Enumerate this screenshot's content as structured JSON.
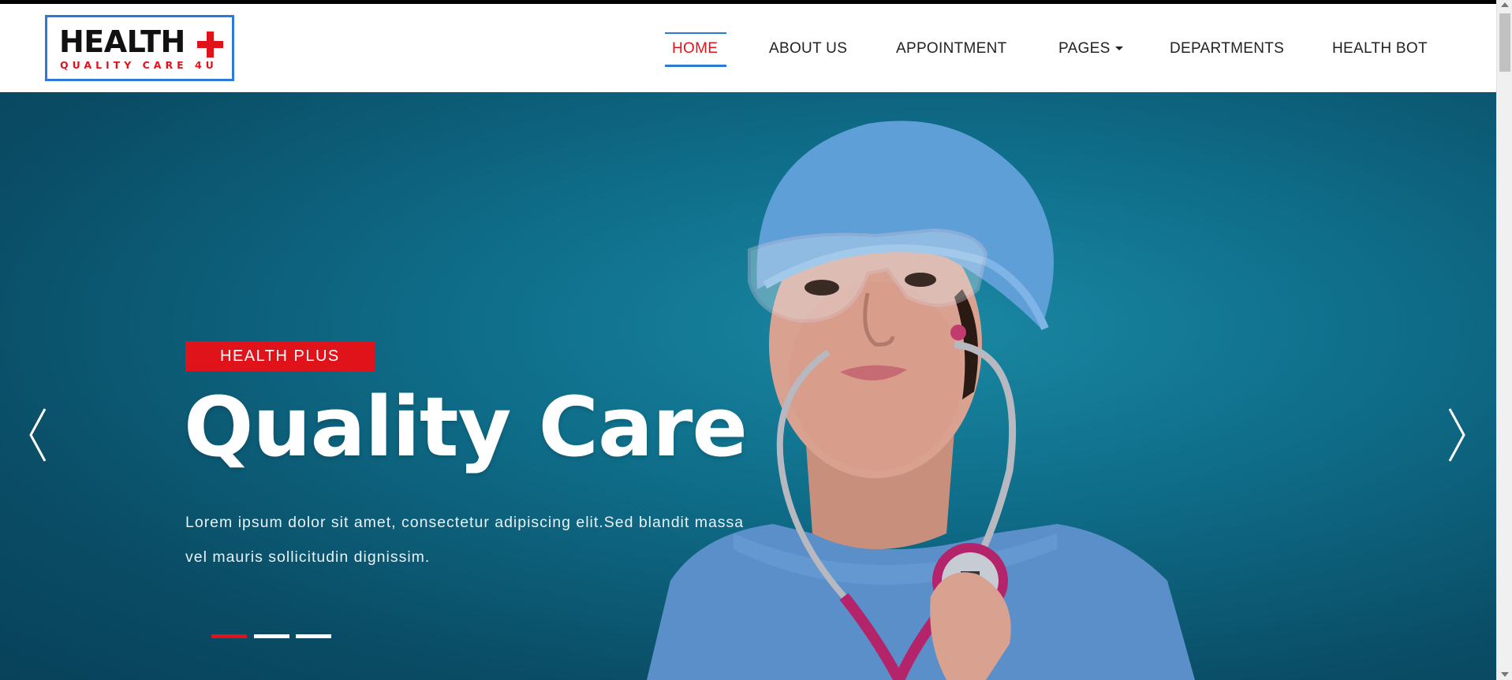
{
  "brand": {
    "name": "HEALTH",
    "tagline": "QUALITY CARE 4U",
    "accent": "#e0131a",
    "border": "#2b7ad6"
  },
  "nav": {
    "items": [
      {
        "label": "HOME",
        "active": true
      },
      {
        "label": "ABOUT US",
        "active": false
      },
      {
        "label": "APPOINTMENT",
        "active": false
      },
      {
        "label": "PAGES",
        "active": false,
        "has_dropdown": true
      },
      {
        "label": "DEPARTMENTS",
        "active": false
      },
      {
        "label": "HEALTH BOT",
        "active": false
      }
    ]
  },
  "hero": {
    "badge": "HEALTH PLUS",
    "title": "Quality Care",
    "text": "Lorem ipsum dolor sit amet, consectetur adipiscing elit.Sed blandit massa vel mauris sollicitudin dignissim.",
    "slides": 3,
    "active_slide": 1
  },
  "icons": {
    "prev": "chevron-left-icon",
    "next": "chevron-right-icon",
    "logo_cross": "medical-cross-icon"
  }
}
